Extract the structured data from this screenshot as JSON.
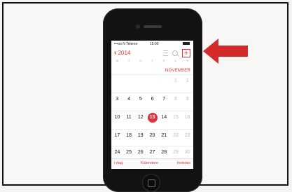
{
  "status_bar": {
    "carrier": "•••oo N Telenor",
    "time": "15:00"
  },
  "nav": {
    "back_label": "2014",
    "add_label": "+"
  },
  "weekdays": [
    "M",
    "T",
    "O",
    "T",
    "F",
    "L",
    "S"
  ],
  "month_label": "NOVEMBER",
  "weeks": [
    [
      "",
      "",
      "",
      "",
      "",
      "1",
      "2"
    ],
    [
      "3",
      "4",
      "5",
      "6",
      "7",
      "8",
      "9"
    ],
    [
      "10",
      "11",
      "12",
      "13",
      "14",
      "15",
      "16"
    ],
    [
      "17",
      "18",
      "19",
      "20",
      "21",
      "22",
      "23"
    ],
    [
      "24",
      "25",
      "26",
      "27",
      "28",
      "29",
      "30"
    ]
  ],
  "today": "13",
  "tabs": {
    "today": "I dag",
    "calendars": "Kalendere",
    "inbox": "Innboks"
  },
  "colors": {
    "accent": "#e0333a",
    "arrow": "#d42a2a"
  },
  "icons": {
    "back": "chevron-left-icon",
    "list": "list-icon",
    "search": "search-icon",
    "add": "plus-icon"
  }
}
